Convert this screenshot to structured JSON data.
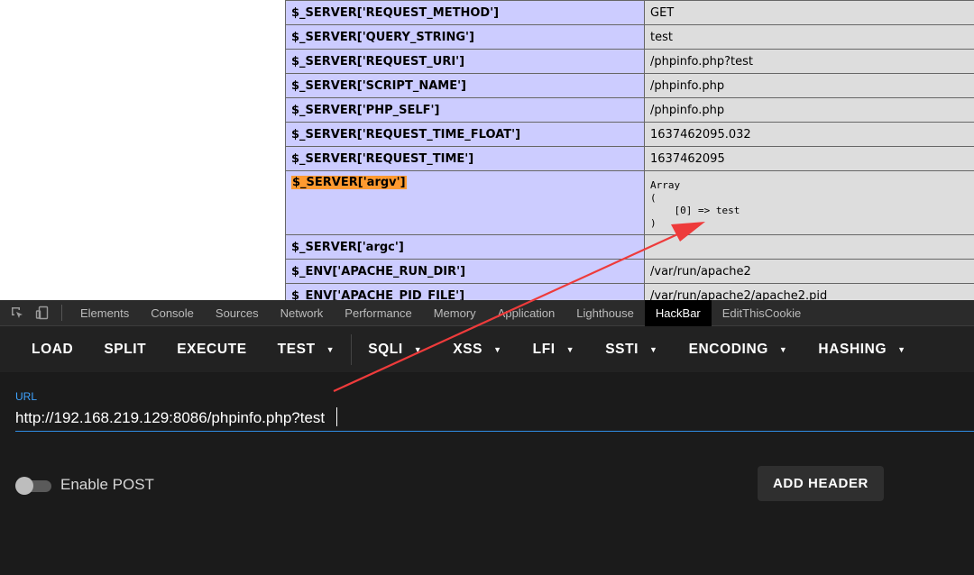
{
  "phpinfo": {
    "rows": [
      {
        "key": "$_SERVER['REQUEST_METHOD']",
        "value": "GET"
      },
      {
        "key": "$_SERVER['QUERY_STRING']",
        "value": "test"
      },
      {
        "key": "$_SERVER['REQUEST_URI']",
        "value": "/phpinfo.php?test"
      },
      {
        "key": "$_SERVER['SCRIPT_NAME']",
        "value": "/phpinfo.php"
      },
      {
        "key": "$_SERVER['PHP_SELF']",
        "value": "/phpinfo.php"
      },
      {
        "key": "$_SERVER['REQUEST_TIME_FLOAT']",
        "value": "1637462095.032"
      },
      {
        "key": "$_SERVER['REQUEST_TIME']",
        "value": "1637462095"
      },
      {
        "key": "$_SERVER['argv']",
        "value": "Array\n(\n    [0] => test\n)"
      },
      {
        "key": "$_SERVER['argc']",
        "value": ""
      },
      {
        "key": "$_ENV['APACHE_RUN_DIR']",
        "value": "/var/run/apache2"
      },
      {
        "key": "$_ENV['APACHE_PID_FILE']",
        "value": "/var/run/apache2/apache2.pid"
      }
    ]
  },
  "devtools": {
    "tabs": [
      "Elements",
      "Console",
      "Sources",
      "Network",
      "Performance",
      "Memory",
      "Application",
      "Lighthouse",
      "HackBar",
      "EditThisCookie"
    ],
    "active_tab": "HackBar"
  },
  "hackbar": {
    "buttons": {
      "load": "LOAD",
      "split": "SPLIT",
      "execute": "EXECUTE",
      "test": "TEST",
      "sqli": "SQLI",
      "xss": "XSS",
      "lfi": "LFI",
      "ssti": "SSTI",
      "encoding": "ENCODING",
      "hashing": "HASHING"
    },
    "url_label": "URL",
    "url_value": "http://192.168.219.129:8086/phpinfo.php?test",
    "enable_post_label": "Enable POST",
    "enable_post": false,
    "add_header_label": "ADD HEADER"
  },
  "colors": {
    "key_cell": "#ccccff",
    "value_cell": "#dddddd",
    "highlight": "#ff9a30",
    "annotation_arrow": "#ee3b3b",
    "accent": "#3fa3ff"
  }
}
